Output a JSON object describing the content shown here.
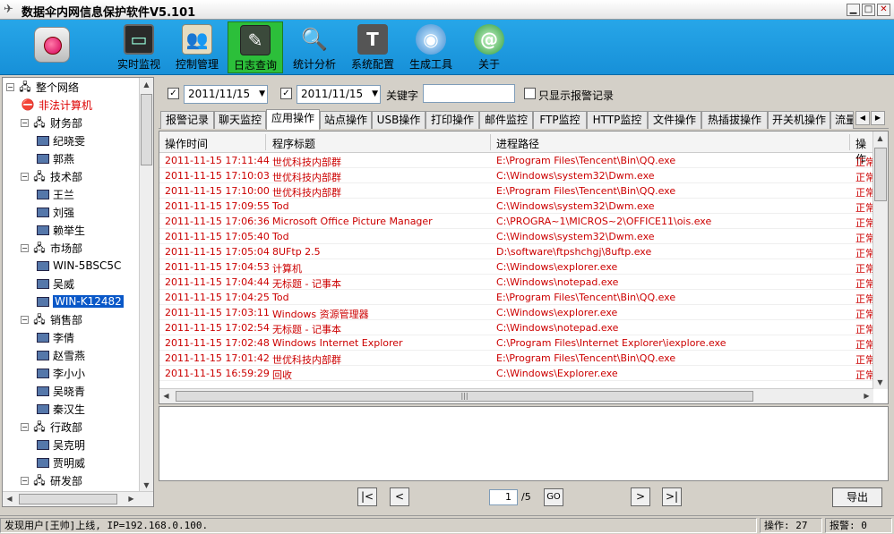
{
  "window": {
    "title": "数据伞内网信息保护软件V5.101",
    "min_icon": "minimize-icon",
    "max_icon": "maximize-icon",
    "close_icon": "close-icon"
  },
  "toolbar": {
    "items": [
      {
        "label": "实时监视",
        "icon": "monitor-icon"
      },
      {
        "label": "控制管理",
        "icon": "users-icon"
      },
      {
        "label": "日志查询",
        "icon": "log-icon"
      },
      {
        "label": "统计分析",
        "icon": "magnifier-icon"
      },
      {
        "label": "系统配置",
        "icon": "hammer-icon"
      },
      {
        "label": "生成工具",
        "icon": "globe-icon"
      },
      {
        "label": "关于",
        "icon": "at-icon"
      }
    ],
    "active_index": 2
  },
  "tree": {
    "root": "整个网络",
    "nodes": [
      {
        "label": "非法计算机",
        "level": 1,
        "type": "alert"
      },
      {
        "label": "财务部",
        "level": 1,
        "type": "group"
      },
      {
        "label": "纪晓雯",
        "level": 2,
        "type": "pc"
      },
      {
        "label": "郭燕",
        "level": 2,
        "type": "pc"
      },
      {
        "label": "技术部",
        "level": 1,
        "type": "group"
      },
      {
        "label": "王兰",
        "level": 2,
        "type": "pc"
      },
      {
        "label": "刘强",
        "level": 2,
        "type": "pc"
      },
      {
        "label": "赖举生",
        "level": 2,
        "type": "pc"
      },
      {
        "label": "市场部",
        "level": 1,
        "type": "group"
      },
      {
        "label": "WIN-5BSC5C",
        "level": 2,
        "type": "pc"
      },
      {
        "label": "吴威",
        "level": 2,
        "type": "pc"
      },
      {
        "label": "WIN-K12482",
        "level": 2,
        "type": "pc",
        "selected": true
      },
      {
        "label": "销售部",
        "level": 1,
        "type": "group"
      },
      {
        "label": "李倩",
        "level": 2,
        "type": "pc"
      },
      {
        "label": "赵雪燕",
        "level": 2,
        "type": "pc"
      },
      {
        "label": "李小小",
        "level": 2,
        "type": "pc"
      },
      {
        "label": "吴晓青",
        "level": 2,
        "type": "pc"
      },
      {
        "label": "秦汉生",
        "level": 2,
        "type": "pc"
      },
      {
        "label": "行政部",
        "level": 1,
        "type": "group"
      },
      {
        "label": "吴克明",
        "level": 2,
        "type": "pc"
      },
      {
        "label": "贾明威",
        "level": 2,
        "type": "pc"
      },
      {
        "label": "研发部",
        "level": 1,
        "type": "group"
      }
    ]
  },
  "filter": {
    "date_from": "2011/11/15",
    "date_to": "2011/11/15",
    "keyword_label": "关键字",
    "keyword_value": "",
    "only_alarm_label": "只显示报警记录"
  },
  "tabs": {
    "items": [
      "报警记录",
      "聊天监控",
      "应用操作",
      "站点操作",
      "USB操作",
      "打印操作",
      "邮件监控",
      "FTP监控",
      "HTTP监控",
      "文件操作",
      "热插拔操作",
      "开关机操作",
      "流量"
    ],
    "active_index": 2
  },
  "table": {
    "columns": [
      "操作时间",
      "程序标题",
      "进程路径",
      "操作"
    ],
    "rows": [
      [
        "2011-11-15 17:11:44",
        "世优科技内部群",
        "E:\\Program Files\\Tencent\\Bin\\QQ.exe",
        "正常"
      ],
      [
        "2011-11-15 17:10:03",
        "世优科技内部群",
        "C:\\Windows\\system32\\Dwm.exe",
        "正常"
      ],
      [
        "2011-11-15 17:10:00",
        "世优科技内部群",
        "E:\\Program Files\\Tencent\\Bin\\QQ.exe",
        "正常"
      ],
      [
        "2011-11-15 17:09:55",
        "Tod",
        "C:\\Windows\\system32\\Dwm.exe",
        "正常"
      ],
      [
        "2011-11-15 17:06:36",
        "Microsoft Office Picture Manager",
        "C:\\PROGRA~1\\MICROS~2\\OFFICE11\\ois.exe",
        "正常"
      ],
      [
        "2011-11-15 17:05:40",
        "Tod",
        "C:\\Windows\\system32\\Dwm.exe",
        "正常"
      ],
      [
        "2011-11-15 17:05:04",
        "8UFtp 2.5",
        "D:\\software\\ftpshchgj\\8uftp.exe",
        "正常"
      ],
      [
        "2011-11-15 17:04:53",
        "计算机",
        "C:\\Windows\\explorer.exe",
        "正常"
      ],
      [
        "2011-11-15 17:04:44",
        "无标题 - 记事本",
        "C:\\Windows\\notepad.exe",
        "正常"
      ],
      [
        "2011-11-15 17:04:25",
        "Tod",
        "E:\\Program Files\\Tencent\\Bin\\QQ.exe",
        "正常"
      ],
      [
        "2011-11-15 17:03:11",
        "Windows 资源管理器",
        "C:\\Windows\\explorer.exe",
        "正常"
      ],
      [
        "2011-11-15 17:02:54",
        "无标题 - 记事本",
        "C:\\Windows\\notepad.exe",
        "正常"
      ],
      [
        "2011-11-15 17:02:48",
        "Windows Internet Explorer",
        "C:\\Program Files\\Internet Explorer\\iexplore.exe",
        "正常"
      ],
      [
        "2011-11-15 17:01:42",
        "世优科技内部群",
        "E:\\Program Files\\Tencent\\Bin\\QQ.exe",
        "正常"
      ],
      [
        "2011-11-15 16:59:29",
        "回收",
        "C:\\Windows\\Explorer.exe",
        "正常"
      ]
    ]
  },
  "pager": {
    "first": "|<",
    "prev": "<",
    "current_page": "1",
    "total_pages": "/5",
    "go": "GO",
    "next": ">",
    "last": ">|",
    "export": "导出"
  },
  "status": {
    "message": "发现用户[王帅]上线, IP=192.168.0.100.",
    "ops": "操作: 27",
    "alarms": "报警: 0"
  },
  "colors": {
    "toolbar_bg": "#1e9be0",
    "active_tool": "#2cbf3a",
    "row_text": "#cc0000",
    "selection": "#0a58c8"
  }
}
